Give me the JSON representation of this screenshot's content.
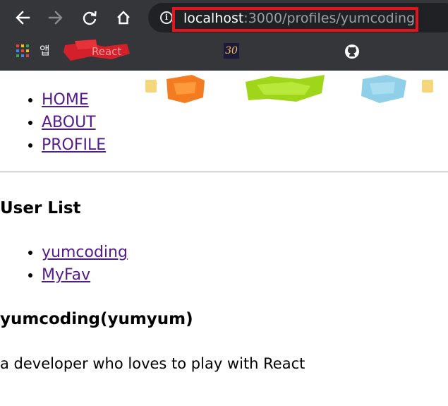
{
  "browser": {
    "url_host": "localhost",
    "url_rest": ":3000/profiles/yumcoding",
    "highlight_color": "#e3141d",
    "icons": {
      "back": "arrow-left-icon",
      "forward": "arrow-right-icon",
      "reload": "reload-icon",
      "home": "home-icon",
      "site_info": "info-icon"
    },
    "bookmarks": {
      "apps_label": "앱",
      "react_label": "React",
      "thirty_label": "30"
    }
  },
  "nav": {
    "items": [
      {
        "label": "HOME"
      },
      {
        "label": "ABOUT"
      },
      {
        "label": "PROFILE"
      }
    ]
  },
  "user_list": {
    "title": "User List",
    "users": [
      {
        "label": "yumcoding"
      },
      {
        "label": "MyFav"
      }
    ]
  },
  "profile": {
    "name": "yumcoding(yumyum)",
    "description": "a developer who loves to play with React"
  },
  "colors": {
    "link_visited": "#551a8b",
    "chrome_bg": "#35363a",
    "omnibox_bg": "#202124"
  }
}
